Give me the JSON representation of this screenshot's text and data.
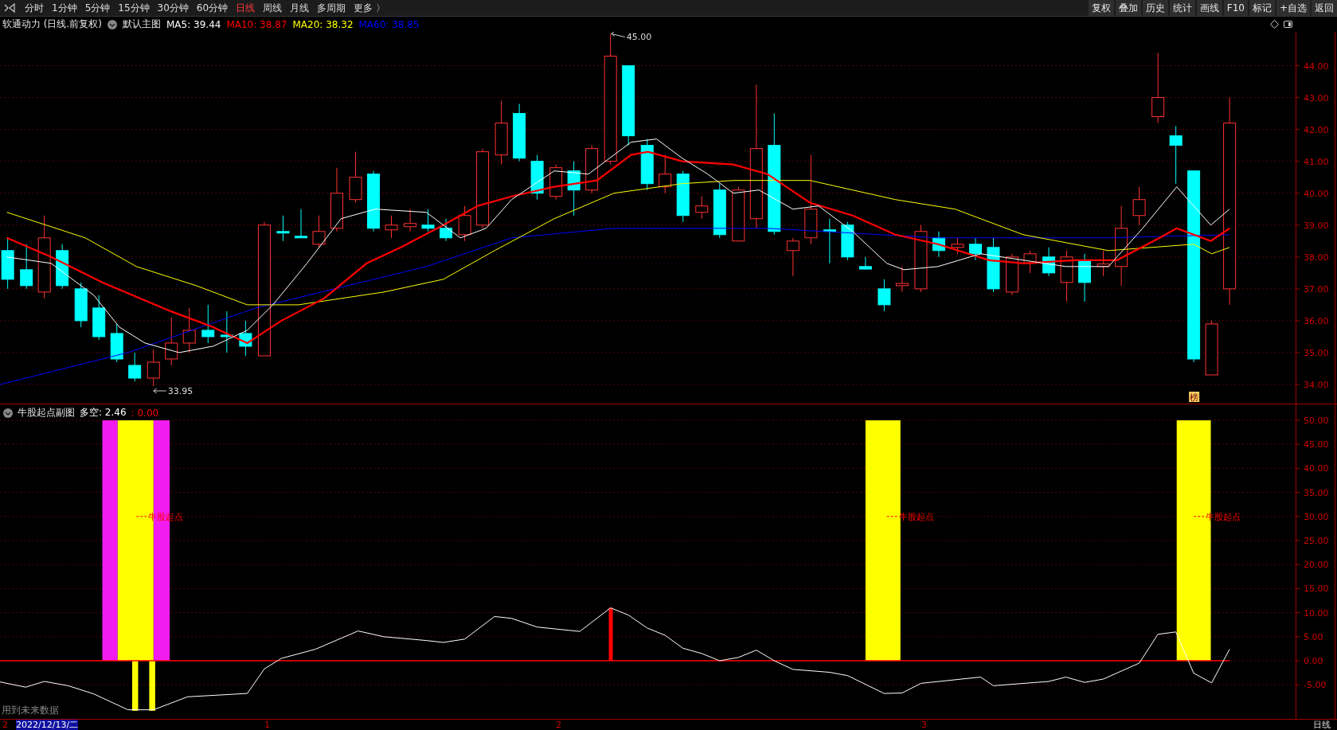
{
  "toolbar": {
    "periods": [
      {
        "label": "分时",
        "selected": false
      },
      {
        "label": "1分钟",
        "selected": false
      },
      {
        "label": "5分钟",
        "selected": false
      },
      {
        "label": "15分钟",
        "selected": false
      },
      {
        "label": "30分钟",
        "selected": false
      },
      {
        "label": "60分钟",
        "selected": false
      },
      {
        "label": "日线",
        "selected": true
      },
      {
        "label": "周线",
        "selected": false
      },
      {
        "label": "月线",
        "selected": false
      },
      {
        "label": "多周期",
        "selected": false
      },
      {
        "label": "更多 〉",
        "selected": false
      }
    ],
    "buttons": [
      "复权",
      "叠加",
      "历史",
      "统计",
      "画线",
      "F10",
      "标记",
      "+自选",
      "返回"
    ]
  },
  "main_chart": {
    "title": "软通动力 (日线.前复权)",
    "indicator": "默认主图",
    "legend": [
      {
        "label": "MA5: 39.44",
        "color": "#ffffff"
      },
      {
        "label": "MA10: 38.87",
        "color": "#ff0000"
      },
      {
        "label": "MA20: 38.32",
        "color": "#ffff00"
      },
      {
        "label": "MA60: 38.85",
        "color": "#0000ff"
      }
    ],
    "price_axis": [
      "44.00",
      "43.00",
      "42.00",
      "41.00",
      "40.00",
      "39.00",
      "38.00",
      "37.00",
      "36.00",
      "35.00",
      "34.00"
    ],
    "high_label": "45.00",
    "low_label": "33.95",
    "badge": "榜"
  },
  "sub_chart": {
    "title": "牛股起点副图",
    "legend": [
      {
        "label": "多空: 2.46",
        "color": "#ffffff"
      },
      {
        "label": ": 0.00",
        "color": "#ff0000"
      }
    ],
    "signals": [
      "牛股起点",
      "牛股起点",
      "牛股起点"
    ],
    "axis": [
      "50.00",
      "45.00",
      "40.00",
      "35.00",
      "30.00",
      "25.00",
      "20.00",
      "15.00",
      "10.00",
      "5.00",
      "0.00",
      "-5.00"
    ],
    "note": "用到未来数据"
  },
  "time_axis": {
    "labels": [
      {
        "label": "2",
        "selected": false
      },
      {
        "label": "2022/12/13/二",
        "selected": true
      },
      {
        "label": "1",
        "selected": false
      },
      {
        "label": "2",
        "selected": false
      },
      {
        "label": "3",
        "selected": false
      }
    ],
    "period": "日线"
  }
}
